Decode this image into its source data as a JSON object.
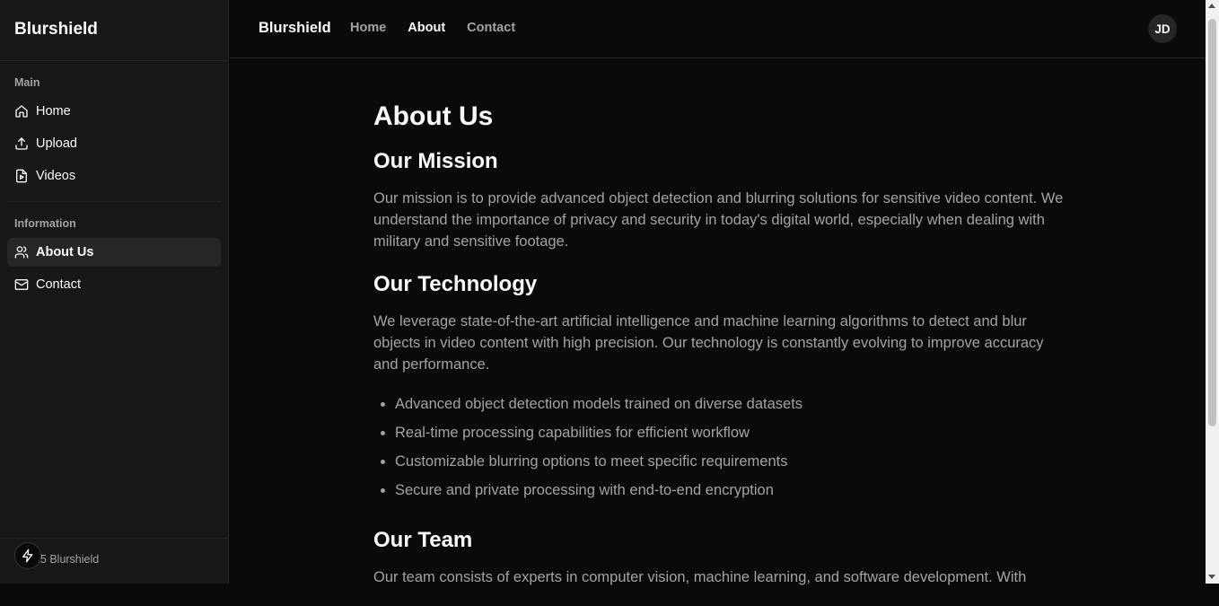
{
  "sidebar": {
    "brand": "Blurshield",
    "groups": [
      {
        "label": "Main",
        "items": [
          {
            "label": "Home",
            "icon": "home-icon"
          },
          {
            "label": "Upload",
            "icon": "upload-icon"
          },
          {
            "label": "Videos",
            "icon": "video-file-icon"
          }
        ]
      },
      {
        "label": "Information",
        "items": [
          {
            "label": "About Us",
            "icon": "users-icon",
            "active": true
          },
          {
            "label": "Contact",
            "icon": "mail-icon"
          }
        ]
      }
    ],
    "footer": "025 Blurshield"
  },
  "topbar": {
    "brand": "Blurshield",
    "nav": [
      {
        "label": "Home"
      },
      {
        "label": "About",
        "active": true
      },
      {
        "label": "Contact"
      }
    ],
    "avatar": "JD"
  },
  "page": {
    "title": "About Us",
    "mission": {
      "heading": "Our Mission",
      "text": "Our mission is to provide advanced object detection and blurring solutions for sensitive video content. We understand the importance of privacy and security in today's digital world, especially when dealing with military and sensitive footage."
    },
    "technology": {
      "heading": "Our Technology",
      "text": "We leverage state-of-the-art artificial intelligence and machine learning algorithms to detect and blur objects in video content with high precision. Our technology is constantly evolving to improve accuracy and performance.",
      "bullets": [
        "Advanced object detection models trained on diverse datasets",
        "Real-time processing capabilities for efficient workflow",
        "Customizable blurring options to meet specific requirements",
        "Secure and private processing with end-to-end encryption"
      ]
    },
    "team": {
      "heading": "Our Team",
      "text": "Our team consists of experts in computer vision, machine learning, and software development. With"
    }
  },
  "colors": {
    "background": "#0a0a0a",
    "sidebar": "#171717",
    "muted_text": "#a3a3a3",
    "foreground": "#fafafa"
  }
}
